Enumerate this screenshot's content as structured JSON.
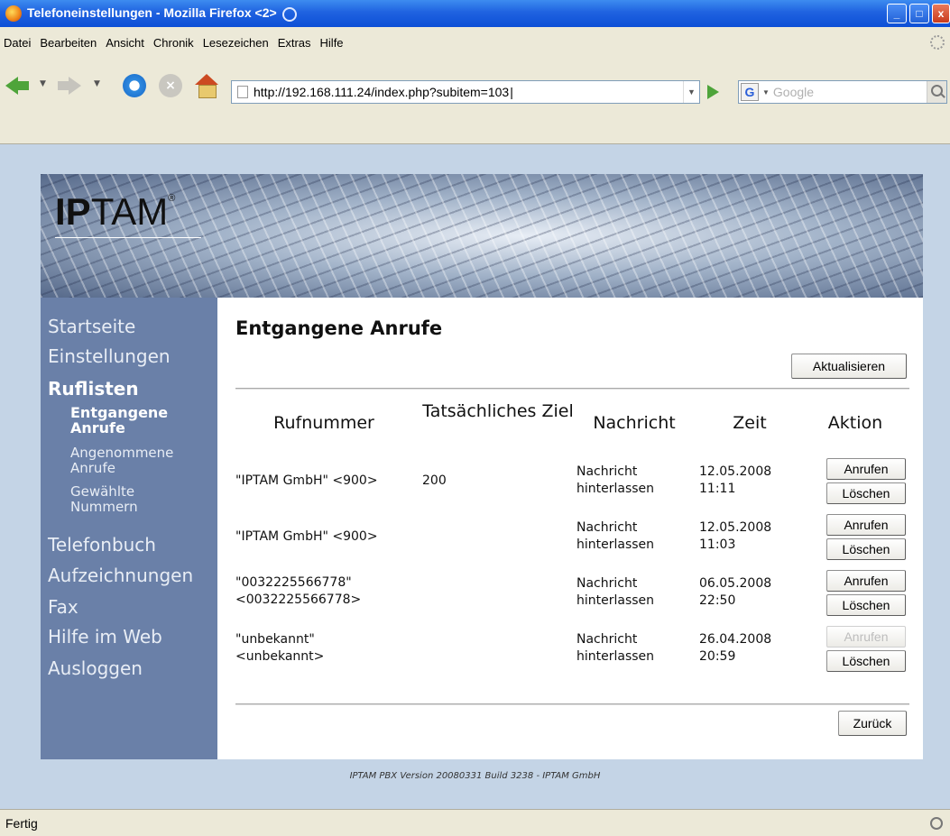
{
  "window": {
    "title": "Telefoneinstellungen - Mozilla Firefox <2>"
  },
  "menu": {
    "items": [
      {
        "label": "Datei",
        "accel": "D"
      },
      {
        "label": "Bearbeiten",
        "accel": "B"
      },
      {
        "label": "Ansicht",
        "accel": "A"
      },
      {
        "label": "Chronik",
        "accel": "C"
      },
      {
        "label": "Lesezeichen",
        "accel": "L"
      },
      {
        "label": "Extras",
        "accel": "x"
      },
      {
        "label": "Hilfe",
        "accel": "H"
      }
    ]
  },
  "toolbar": {
    "url": "http://192.168.111.24/index.php?subitem=103",
    "search_engine": "Google"
  },
  "brand": {
    "logo_bold": "IP",
    "logo_light": "TAM",
    "logo_mark": "®"
  },
  "sidebar": {
    "startseite": "Startseite",
    "einstellungen": "Einstellungen",
    "ruflisten": "Ruflisten",
    "entgangene": "Entgangene Anrufe",
    "angenommene": "Angenommene Anrufe",
    "gewaehlte": "Gewählte Nummern",
    "telefonbuch": "Telefonbuch",
    "aufzeichnungen": "Aufzeichnungen",
    "fax": "Fax",
    "hilfe": "Hilfe im Web",
    "ausloggen": "Ausloggen"
  },
  "main": {
    "heading": "Entgangene Anrufe",
    "refresh": "Aktualisieren",
    "back": "Zurück",
    "columns": {
      "number": "Rufnummer",
      "target": "Tatsächliches Ziel",
      "message": "Nachricht",
      "time": "Zeit",
      "action": "Aktion"
    },
    "rows": [
      {
        "number": "\"IPTAM GmbH\" <900>",
        "target": "200",
        "message": "Nachricht hinterlassen",
        "date": "12.05.2008",
        "time": "11:11",
        "call": "Anrufen",
        "delete": "Löschen"
      },
      {
        "number": "\"IPTAM GmbH\" <900>",
        "target": "",
        "message": "Nachricht hinterlassen",
        "date": "12.05.2008",
        "time": "11:03",
        "call": "Anrufen",
        "delete": "Löschen"
      },
      {
        "number": "\"0032225566778\" <0032225566778>",
        "target": "",
        "message": "Nachricht hinterlassen",
        "date": "06.05.2008",
        "time": "22:50",
        "call": "Anrufen",
        "delete": "Löschen"
      },
      {
        "number": "\"unbekannt\" <unbekannt>",
        "target": "",
        "message": "Nachricht hinterlassen",
        "date": "26.04.2008",
        "time": "20:59",
        "call": "Anrufen",
        "delete": "Löschen",
        "call_disabled": true
      }
    ]
  },
  "footer": "IPTAM PBX Version 20080331 Build 3238 - IPTAM GmbH",
  "status": "Fertig"
}
